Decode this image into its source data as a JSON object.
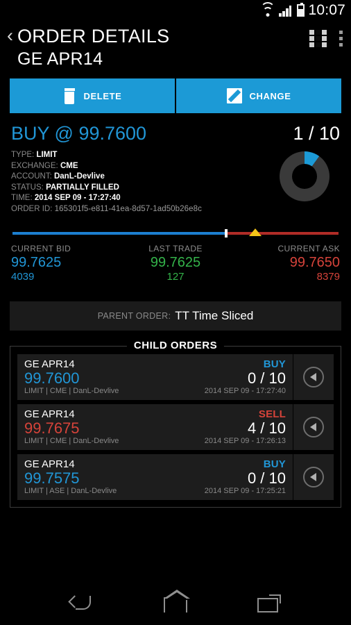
{
  "status_bar": {
    "wifi_icon": "wifi-icon",
    "signal_icon": "signal-icon",
    "battery_icon": "battery-icon",
    "time": "10:07"
  },
  "app_bar": {
    "back_icon": "‹",
    "title": "ORDER DETAILS",
    "subtitle": "GE APR14",
    "grid_icon": "grid-icon",
    "overflow_icon": "overflow-menu-icon"
  },
  "actions": {
    "delete": {
      "label": "DELETE",
      "icon": "trash-icon"
    },
    "change": {
      "label": "CHANGE",
      "icon": "pencil-icon"
    }
  },
  "summary": {
    "heading": "BUY @ 99.7600",
    "quantity": "1 / 10",
    "fill_percent": 10,
    "accent_color": "#1c9ad6",
    "fields": [
      {
        "key": "TYPE:",
        "value": "LIMIT"
      },
      {
        "key": "EXCHANGE:",
        "value": "CME"
      },
      {
        "key": "ACCOUNT:",
        "value": "DanL-Devlive"
      },
      {
        "key": "STATUS:",
        "value": "PARTIALLY FILLED"
      },
      {
        "key": "TIME:",
        "value": "2014 SEP 09 - 17:27:40"
      },
      {
        "key": "ORDER ID:",
        "value": "165301f5-e811-41ea-8d57-1ad50b26e8c"
      }
    ]
  },
  "price_bar": {
    "bid_fraction": 0.655,
    "tick_position": 0.655,
    "triangle_position": 0.745,
    "bid_color": "#1c7fd0",
    "ask_color": "#b02c26",
    "tick_color": "#ffffff",
    "triangle_color": "#f5c518"
  },
  "quotes": [
    {
      "label": "CURRENT BID",
      "price": "99.7625",
      "size": "4039",
      "color": "#2196d6"
    },
    {
      "label": "LAST TRADE",
      "price": "99.7625",
      "size": "127",
      "color": "#34b34a"
    },
    {
      "label": "CURRENT ASK",
      "price": "99.7650",
      "size": "8379",
      "color": "#d6433a"
    }
  ],
  "parent_order": {
    "label": "PARENT ORDER:",
    "value": "TT Time Sliced"
  },
  "child_orders": {
    "legend": "CHILD ORDERS",
    "rows": [
      {
        "symbol": "GE APR14",
        "side": "BUY",
        "price": "99.7600",
        "quantity": "0 / 10",
        "meta": "LIMIT | CME | DanL-Devlive",
        "time": "2014 SEP 09 - 17:27:40",
        "arrow_icon": "chevron-left-icon"
      },
      {
        "symbol": "GE APR14",
        "side": "SELL",
        "price": "99.7675",
        "quantity": "4 / 10",
        "meta": "LIMIT | CME | DanL-Devlive",
        "time": "2014 SEP 09 - 17:26:13",
        "arrow_icon": "chevron-left-icon"
      },
      {
        "symbol": "GE APR14",
        "side": "BUY",
        "price": "99.7575",
        "quantity": "0 / 10",
        "meta": "LIMIT | ASE | DanL-Devlive",
        "time": "2014 SEP 09 - 17:25:21",
        "arrow_icon": "chevron-left-icon"
      }
    ]
  },
  "nav_bar": {
    "back_icon": "back-icon",
    "home_icon": "home-icon",
    "recents_icon": "recents-icon"
  }
}
